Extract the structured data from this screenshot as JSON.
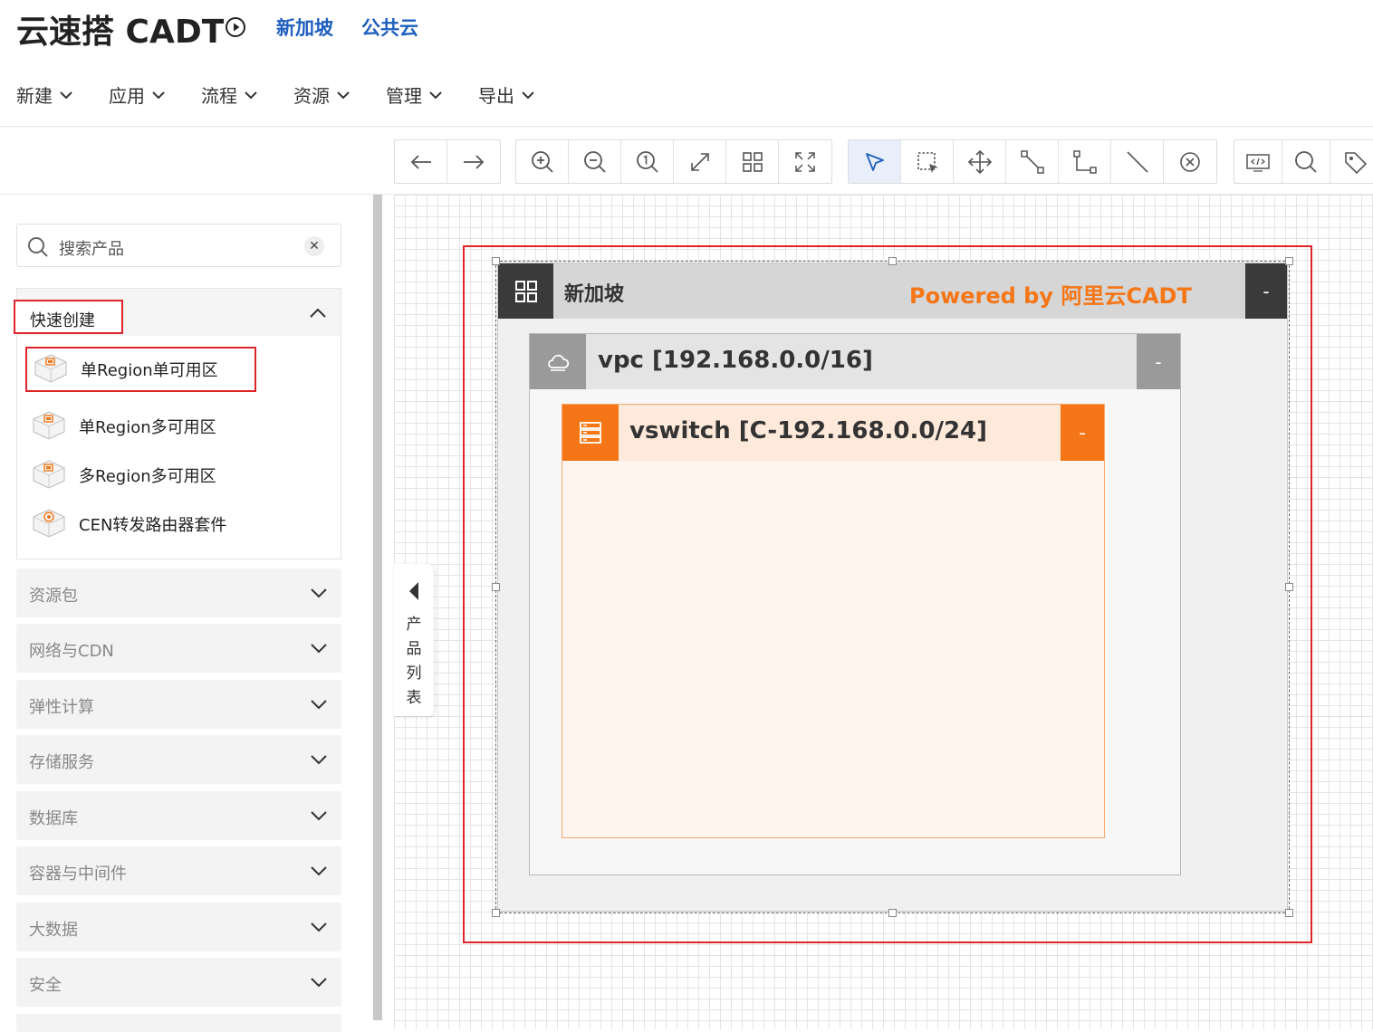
{
  "header": {
    "title": "云速搭 CADT",
    "links": [
      "新加坡",
      "公共云"
    ]
  },
  "menu": [
    "新建",
    "应用",
    "流程",
    "资源",
    "管理",
    "导出"
  ],
  "toolbar": {
    "groups": [
      [
        "arrow-left-icon",
        "arrow-right-icon"
      ],
      [
        "zoom-in-icon",
        "zoom-out-icon",
        "zoom-reset-icon",
        "expand-icon",
        "grid-icon",
        "fullscreen-icon"
      ],
      [
        "pointer-icon",
        "box-select-icon",
        "move-icon",
        "connector-icon",
        "elbow-connector-icon",
        "line-icon",
        "cancel-icon"
      ],
      [
        "code-icon",
        "search-icon",
        "tag-icon"
      ]
    ],
    "active": "pointer-icon"
  },
  "sidebar": {
    "search_placeholder": "搜索产品",
    "quick_title": "快速创建",
    "quick_items": [
      "单Region单可用区",
      "单Region多可用区",
      "多Region多可用区",
      "CEN转发路由器套件"
    ],
    "categories": [
      "资源包",
      "网络与CDN",
      "弹性计算",
      "存储服务",
      "数据库",
      "容器与中间件",
      "大数据",
      "安全"
    ]
  },
  "collapse_tab": {
    "label": [
      "产",
      "品",
      "列",
      "表"
    ]
  },
  "diagram": {
    "region_name": "新加坡",
    "powered_by": "Powered by 阿里云CADT",
    "vpc_label": "vpc [192.168.0.0/16]",
    "vswitch_label": "vswitch [C-192.168.0.0/24]",
    "minimize": "-",
    "colors": {
      "accent": "#f57616",
      "highlight": "#e0242b",
      "link": "#1e5fbf"
    }
  }
}
